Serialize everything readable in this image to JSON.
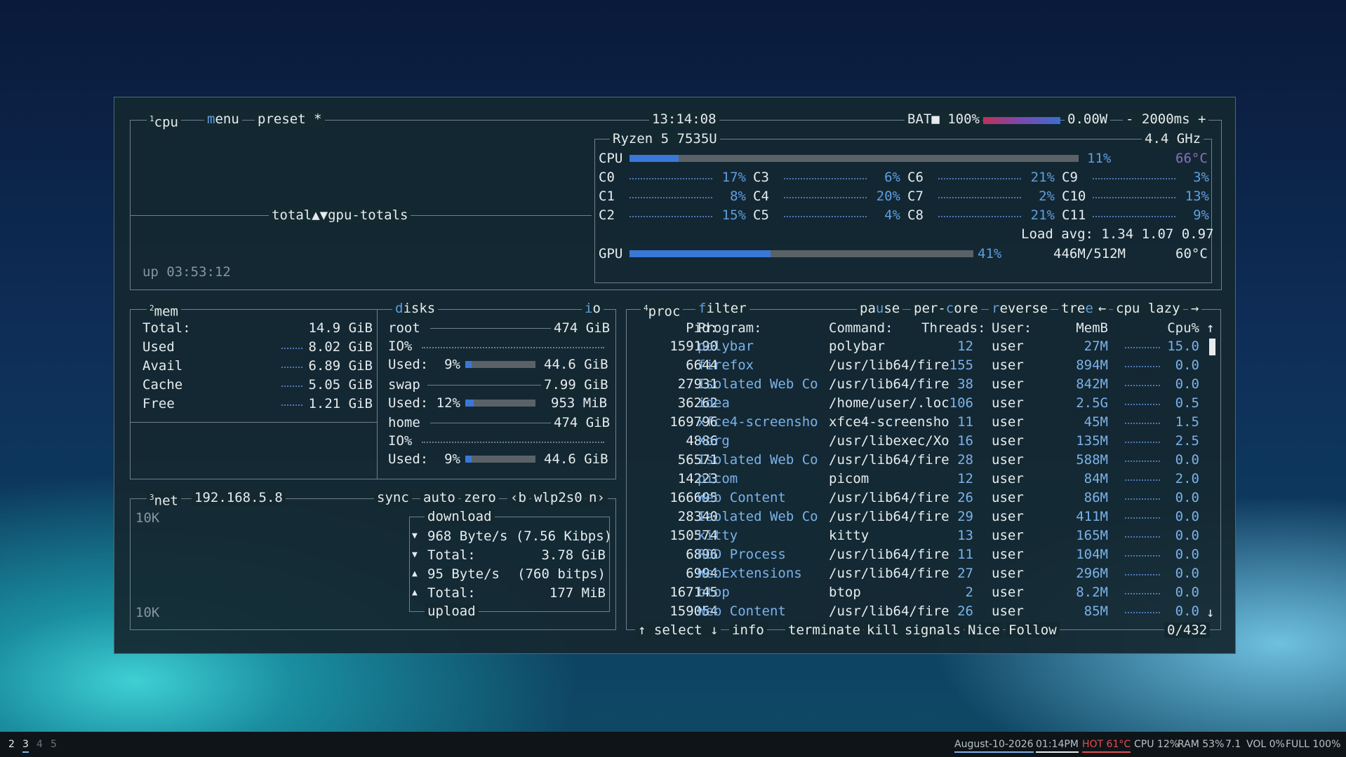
{
  "cpu": {
    "title": "cpu",
    "num": "1",
    "menu": "menu",
    "preset": "preset *",
    "clock": "13:14:08",
    "battery": "BAT■ 100%",
    "power": "0.00W",
    "interval": "- 2000ms +",
    "model": "Ryzen 5 7535U",
    "freq": "4.4 GHz",
    "total_label": "CPU",
    "total_pct": "11%",
    "total_temp": "66°C",
    "graph_label": "total▲▼gpu-totals",
    "uptime": "up 03:53:12",
    "load": "Load avg: 1.34 1.07 0.97",
    "gpu_label": "GPU",
    "gpu_pct": "41%",
    "gpu_mem": "446M/512M",
    "gpu_temp": "60°C",
    "cores": [
      {
        "name": "C0",
        "pct": "17%"
      },
      {
        "name": "C1",
        "pct": "8%"
      },
      {
        "name": "C2",
        "pct": "15%"
      },
      {
        "name": "C3",
        "pct": "6%"
      },
      {
        "name": "C4",
        "pct": "20%"
      },
      {
        "name": "C5",
        "pct": "4%"
      },
      {
        "name": "C6",
        "pct": "21%"
      },
      {
        "name": "C7",
        "pct": "2%"
      },
      {
        "name": "C8",
        "pct": "21%"
      },
      {
        "name": "C9",
        "pct": "3%"
      },
      {
        "name": "C10",
        "pct": "13%"
      },
      {
        "name": "C11",
        "pct": "9%"
      }
    ],
    "total_level": 0.11,
    "gpu_level": 0.41,
    "battery_level": 1.0
  },
  "mem": {
    "num": "2",
    "title": "mem",
    "rows": [
      {
        "label": "Total:",
        "value": "14.9 GiB"
      },
      {
        "label": "Used",
        "value": "8.02 GiB"
      },
      {
        "label": "Avail",
        "value": "6.89 GiB"
      },
      {
        "label": "Cache",
        "value": "5.05 GiB"
      },
      {
        "label": "Free",
        "value": "1.21 GiB"
      }
    ]
  },
  "disks": {
    "title": "disks",
    "io": "io",
    "root": {
      "name": "root",
      "size": "474 GiB",
      "io": "IO%",
      "used_label": "Used:  9%",
      "used": "44.6 GiB",
      "level": 0.09
    },
    "swap": {
      "name": "swap",
      "size": "7.99 GiB",
      "used_label": "Used: 12%",
      "used": "953 MiB",
      "level": 0.12
    },
    "home": {
      "name": "home",
      "size": "474 GiB",
      "io": "IO%",
      "used_label": "Used:  9%",
      "used": "44.6 GiB",
      "level": 0.09
    }
  },
  "net": {
    "num": "3",
    "title": "net",
    "ip": "192.168.5.8",
    "sync": "sync",
    "auto": "auto",
    "zero": "zero",
    "prev": "‹b",
    "iface": "wlp2s0",
    "next": "n›",
    "scale_top": "10K",
    "scale_bottom": "10K",
    "download": "download",
    "upload": "upload",
    "rows": [
      {
        "icon": "▼",
        "label": "968 Byte/s (7.56 Kibps)",
        "value": ""
      },
      {
        "icon": "▼",
        "label": "Total:",
        "value": "3.78 GiB"
      },
      {
        "icon": "▲",
        "label": "95 Byte/s",
        "value": "(760 bitps)"
      },
      {
        "icon": "▲",
        "label": "Total:",
        "value": "177 MiB"
      }
    ]
  },
  "proc": {
    "num": "4",
    "title": "proc",
    "filter": "filter",
    "pause": "pause",
    "percore": "per-core",
    "reverse": "reverse",
    "tree": "tree",
    "sort_prev": "←",
    "sort": "cpu lazy",
    "sort_next": "→",
    "headers": {
      "pid": "Pid:",
      "program": "Program:",
      "command": "Command:",
      "threads": "Threads:",
      "user": "User:",
      "mem": "MemB",
      "cpu": "Cpu%"
    },
    "rows": [
      {
        "pid": "159190",
        "program": "polybar",
        "command": "polybar",
        "threads": "12",
        "user": "user",
        "mem": "27M",
        "cpu": "15.0"
      },
      {
        "pid": "6644",
        "program": "firefox",
        "command": "/usr/lib64/fire",
        "threads": "155",
        "user": "user",
        "mem": "894M",
        "cpu": "0.0"
      },
      {
        "pid": "27931",
        "program": "Isolated Web Co",
        "command": "/usr/lib64/fire",
        "threads": "38",
        "user": "user",
        "mem": "842M",
        "cpu": "0.0"
      },
      {
        "pid": "36262",
        "program": "idea",
        "command": "/home/user/.loc",
        "threads": "106",
        "user": "user",
        "mem": "2.5G",
        "cpu": "0.5"
      },
      {
        "pid": "169796",
        "program": "xfce4-screensho",
        "command": "xfce4-screensho",
        "threads": "11",
        "user": "user",
        "mem": "45M",
        "cpu": "1.5"
      },
      {
        "pid": "4886",
        "program": "Xorg",
        "command": "/usr/libexec/Xo",
        "threads": "16",
        "user": "user",
        "mem": "135M",
        "cpu": "2.5"
      },
      {
        "pid": "56571",
        "program": "Isolated Web Co",
        "command": "/usr/lib64/fire",
        "threads": "28",
        "user": "user",
        "mem": "588M",
        "cpu": "0.0"
      },
      {
        "pid": "14223",
        "program": "picom",
        "command": "picom",
        "threads": "12",
        "user": "user",
        "mem": "84M",
        "cpu": "2.0"
      },
      {
        "pid": "166695",
        "program": "Web Content",
        "command": "/usr/lib64/fire",
        "threads": "26",
        "user": "user",
        "mem": "86M",
        "cpu": "0.0"
      },
      {
        "pid": "28340",
        "program": "Isolated Web Co",
        "command": "/usr/lib64/fire",
        "threads": "29",
        "user": "user",
        "mem": "411M",
        "cpu": "0.0"
      },
      {
        "pid": "150574",
        "program": "kitty",
        "command": "kitty",
        "threads": "13",
        "user": "user",
        "mem": "165M",
        "cpu": "0.0"
      },
      {
        "pid": "6896",
        "program": "RDD Process",
        "command": "/usr/lib64/fire",
        "threads": "11",
        "user": "user",
        "mem": "104M",
        "cpu": "0.0"
      },
      {
        "pid": "6994",
        "program": "WebExtensions",
        "command": "/usr/lib64/fire",
        "threads": "27",
        "user": "user",
        "mem": "296M",
        "cpu": "0.0"
      },
      {
        "pid": "167145",
        "program": "btop",
        "command": "btop",
        "threads": "2",
        "user": "user",
        "mem": "8.2M",
        "cpu": "0.0"
      },
      {
        "pid": "159054",
        "program": "Web Content",
        "command": "/usr/lib64/fire",
        "threads": "26",
        "user": "user",
        "mem": "85M",
        "cpu": "0.0"
      }
    ],
    "footer": {
      "select": "↑ select ↓",
      "info": "info",
      "terminate": "terminate",
      "kill": "kill",
      "signals": "signals",
      "nice": "Nice",
      "follow": "Follow",
      "count": "0/432"
    }
  },
  "taskbar": {
    "workspaces": [
      "2",
      "3",
      "4",
      "5"
    ],
    "date": "August-10-2026",
    "time": "01:14PM",
    "hot": "HOT 61°C",
    "cpu": "CPU 12%",
    "ram": "RAM 53%",
    "n": "7.1",
    "vol": "VOL 0%",
    "full": "FULL 100%"
  },
  "colors": {
    "accent": "#5f9ee0",
    "hot": "#e05050",
    "text": "#c9d4d8"
  }
}
